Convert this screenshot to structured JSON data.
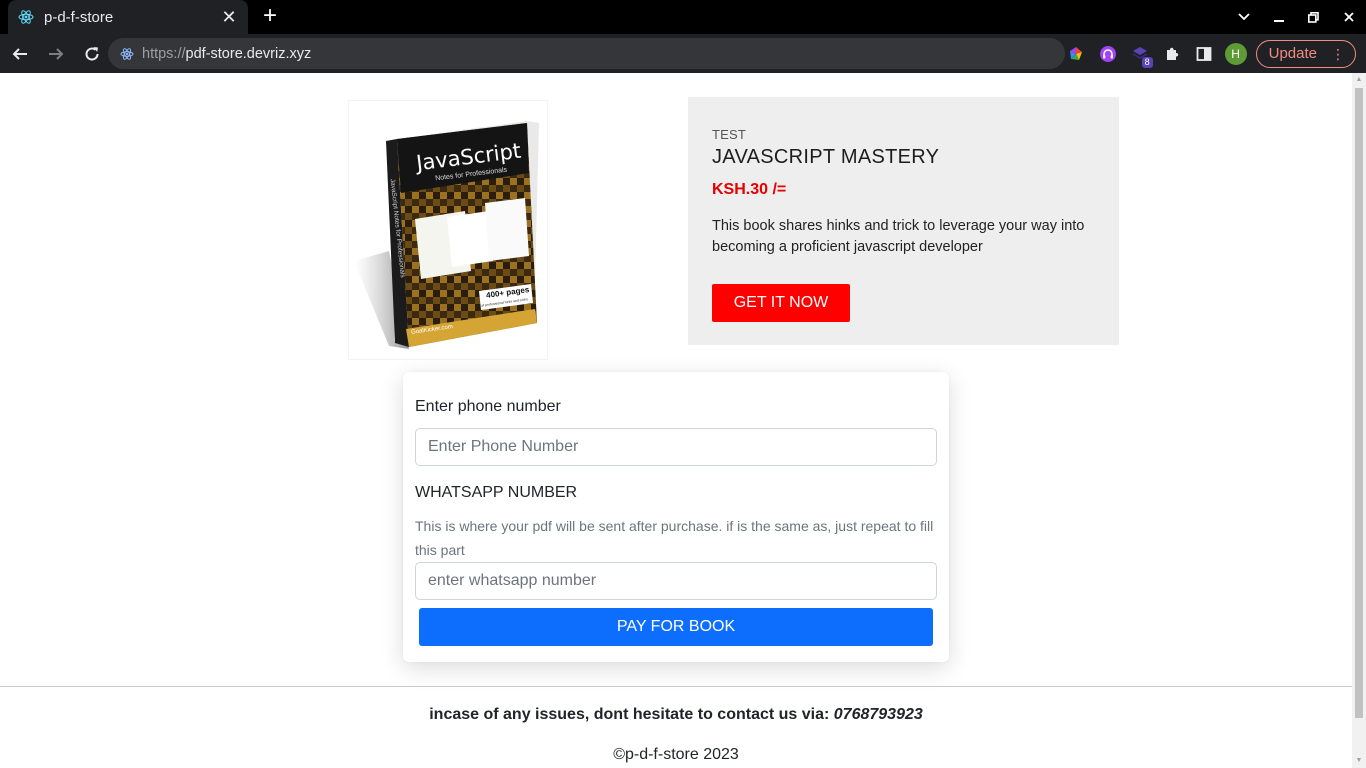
{
  "browser": {
    "tab_title": "p-d-f-store",
    "tab_close": "✕",
    "new_tab": "+",
    "url_scheme": "https://",
    "url_host": "pdf-store.devriz.xyz",
    "extension_badge": "8",
    "profile_initial": "H",
    "update_label": "Update",
    "update_menu": "⋮",
    "win_minimize": "—",
    "win_maximize": "❐",
    "win_close": "✕",
    "tab_list": "⌄"
  },
  "product": {
    "cover": {
      "title": "JavaScript",
      "subtitle": "Notes for Professionals",
      "spine": "JavaScript Notes for Professionals",
      "pages_badge": "400+ pages",
      "pages_badge_sub": "of professional hints and tricks",
      "publisher": "GoalKicker.com"
    },
    "category": "TEST",
    "title": "JAVASCRIPT MASTERY",
    "price": "KSH.30 /=",
    "description": "This book shares hinks and trick to leverage your way into becoming a proficient javascript developer",
    "cta_label": "GET IT NOW"
  },
  "form": {
    "phone_label": "Enter phone number",
    "phone_placeholder": "Enter Phone Number",
    "whatsapp_label": "WHATSAPP NUMBER",
    "whatsapp_help": "This is where your pdf will be sent after purchase. if is the same as, just repeat to fill this part",
    "whatsapp_placeholder": "enter whatsapp number",
    "submit_label": "PAY FOR BOOK"
  },
  "footer": {
    "contact_text": "incase of any issues, dont hesitate to contact us via: ",
    "contact_phone": "0768793923",
    "copyright": "©p-d-f-store 2023"
  },
  "colors": {
    "cta_red": "#ff0000",
    "price_red": "#e60000",
    "pay_blue": "#0d6efd",
    "card_gray": "#eeeeee"
  }
}
